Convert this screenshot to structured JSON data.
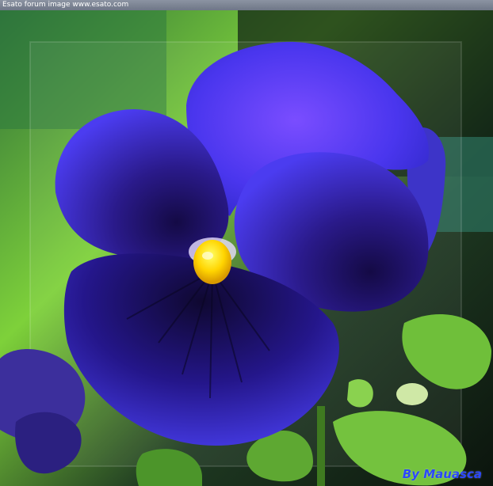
{
  "header": {
    "caption": "Esato forum image www.esato.com"
  },
  "photo": {
    "subject_icon": "pansy-flower-icon",
    "colors": {
      "petal": "#3b35e0",
      "petal_light": "#6a4cff",
      "petal_dark": "#1a0f5a",
      "center": "#ffd400",
      "leaf": "#6fbf3a",
      "background_green": "#4a9a2a"
    }
  },
  "signature": {
    "text": "By Mauasca"
  }
}
